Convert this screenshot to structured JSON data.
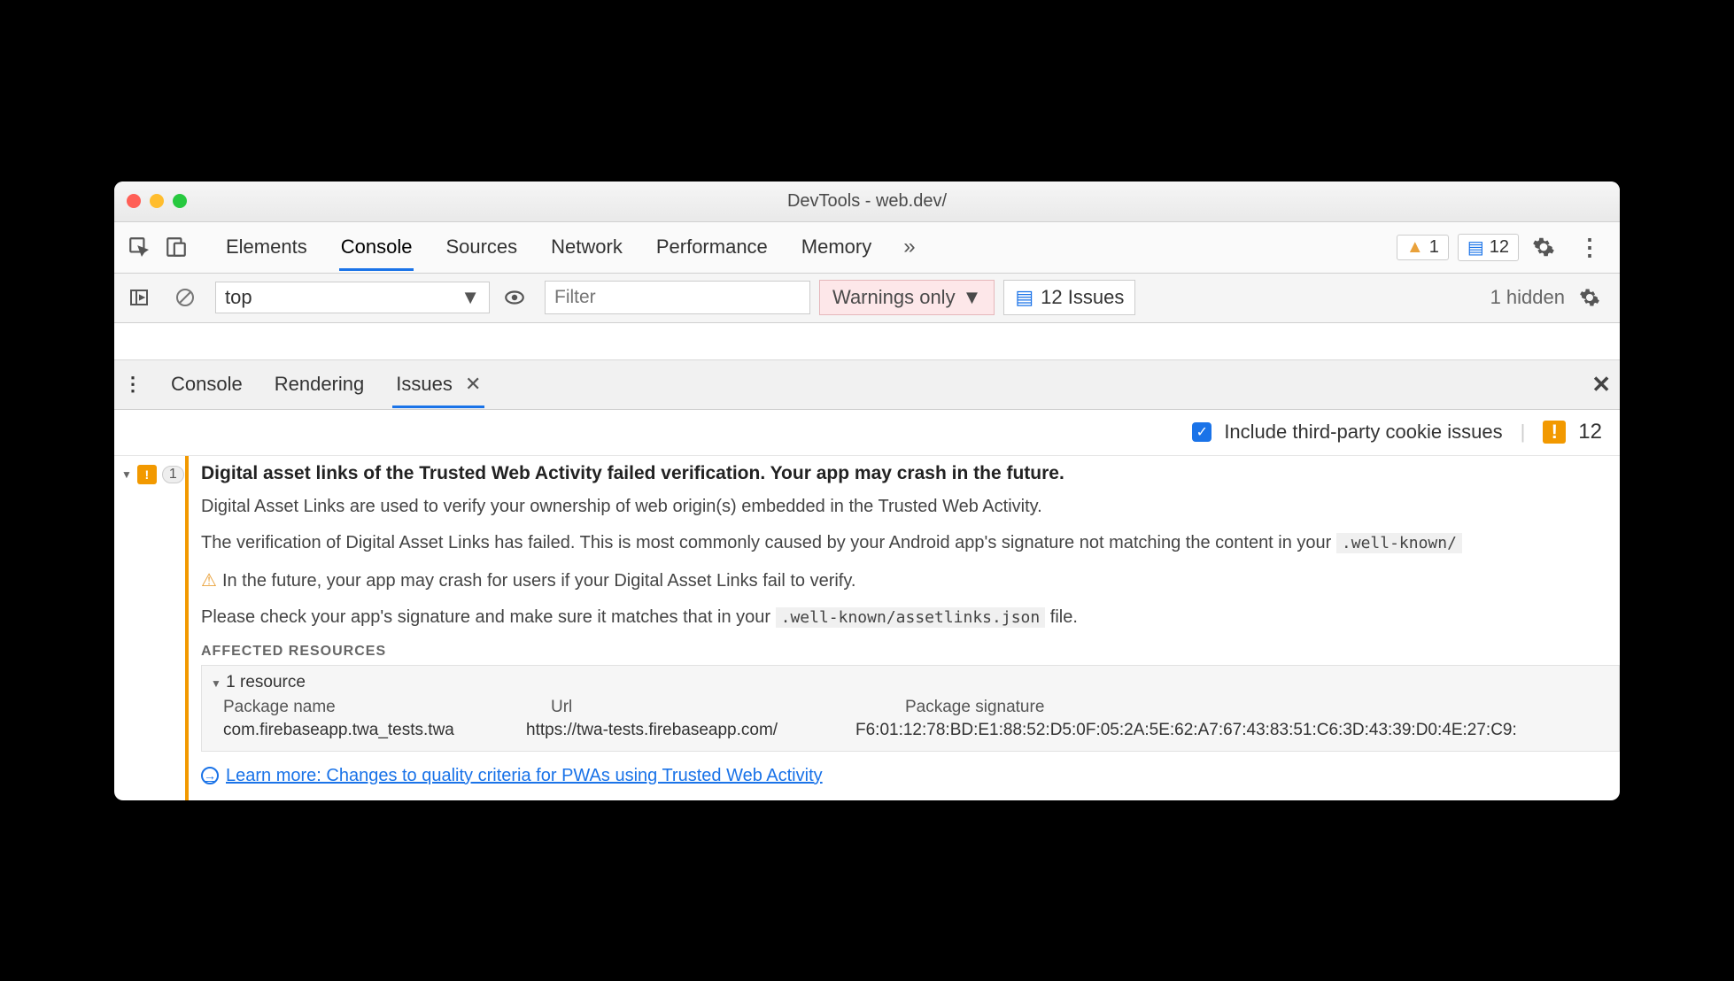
{
  "titlebar": {
    "title": "DevTools - web.dev/"
  },
  "main_tabs": {
    "elements": "Elements",
    "console": "Console",
    "sources": "Sources",
    "network": "Network",
    "performance": "Performance",
    "memory": "Memory"
  },
  "badges": {
    "warning_count": "1",
    "issue_count": "12"
  },
  "console_bar": {
    "context": "top",
    "filter_placeholder": "Filter",
    "level": "Warnings only",
    "issues_btn": "12 Issues",
    "hidden": "1 hidden"
  },
  "drawer_tabs": {
    "console": "Console",
    "rendering": "Rendering",
    "issues": "Issues"
  },
  "issues_header": {
    "include_label": "Include third-party cookie issues",
    "total": "12"
  },
  "issue": {
    "count_badge": "1",
    "title": "Digital asset links of the Trusted Web Activity failed verification. Your app may crash in the future.",
    "p1": "Digital Asset Links are used to verify your ownership of web origin(s) embedded in the Trusted Web Activity.",
    "p2_a": "The verification of Digital Asset Links has failed. This is most commonly caused by your Android app's signature not matching the content in your ",
    "p2_code": ".well-known/",
    "p3": "In the future, your app may crash for users if your Digital Asset Links fail to verify.",
    "p4_a": "Please check your app's signature and make sure it matches that in your ",
    "p4_code": ".well-known/assetlinks.json",
    "p4_b": " file.",
    "affected_label": "AFFECTED RESOURCES",
    "resource_count": "1 resource",
    "cols": {
      "pkg": "Package name",
      "url": "Url",
      "sig": "Package signature"
    },
    "row": {
      "pkg": "com.firebaseapp.twa_tests.twa",
      "url": "https://twa-tests.firebaseapp.com/",
      "sig": "F6:01:12:78:BD:E1:88:52:D5:0F:05:2A:5E:62:A7:67:43:83:51:C6:3D:43:39:D0:4E:27:C9:"
    },
    "learn_more": "Learn more: Changes to quality criteria for PWAs using Trusted Web Activity"
  }
}
